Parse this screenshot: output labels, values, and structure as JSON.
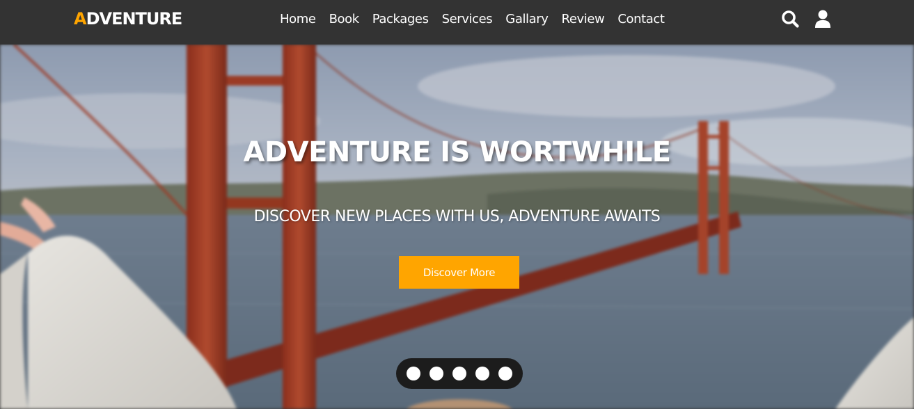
{
  "brand": {
    "first_letter": "A",
    "rest": "DVENTURE"
  },
  "nav": {
    "links": [
      "Home",
      "Book",
      "Packages",
      "Services",
      "Gallary",
      "Review",
      "Contact"
    ],
    "icons": [
      "search-icon",
      "user-icon"
    ]
  },
  "hero": {
    "title": "ADVENTURE IS WORTWHILE",
    "subtitle": "DISCOVER NEW PLACES WITH US, ADVENTURE AWAITS",
    "cta_label": "Discover More",
    "slide_count": 5
  },
  "colors": {
    "navbar": "#333333",
    "accent": "#ffa500",
    "text": "#ffffff",
    "dots_bg": "#1c1c1c"
  }
}
